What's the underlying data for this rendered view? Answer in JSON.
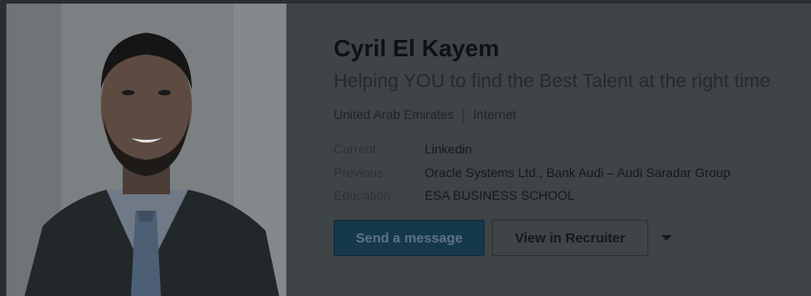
{
  "profile": {
    "name": "Cyril El Kayem",
    "headline": "Helping YOU to find the Best Talent at the right time",
    "location": "United Arab Emirates",
    "industry": "Internet"
  },
  "details": [
    {
      "key": "Current",
      "value": "Linkedin"
    },
    {
      "key": "Previous",
      "value": "Oracle Systems Ltd., Bank Audi – Audi Saradar Group"
    },
    {
      "key": "Education",
      "value": "ESA BUSINESS SCHOOL"
    }
  ],
  "actions": {
    "send_message": "Send a message",
    "view_recruiter": "View in Recruiter",
    "more_icon": "chevron-down-icon"
  },
  "colors": {
    "primary_button": "#16384b",
    "overlay_background": "#3f4446"
  }
}
